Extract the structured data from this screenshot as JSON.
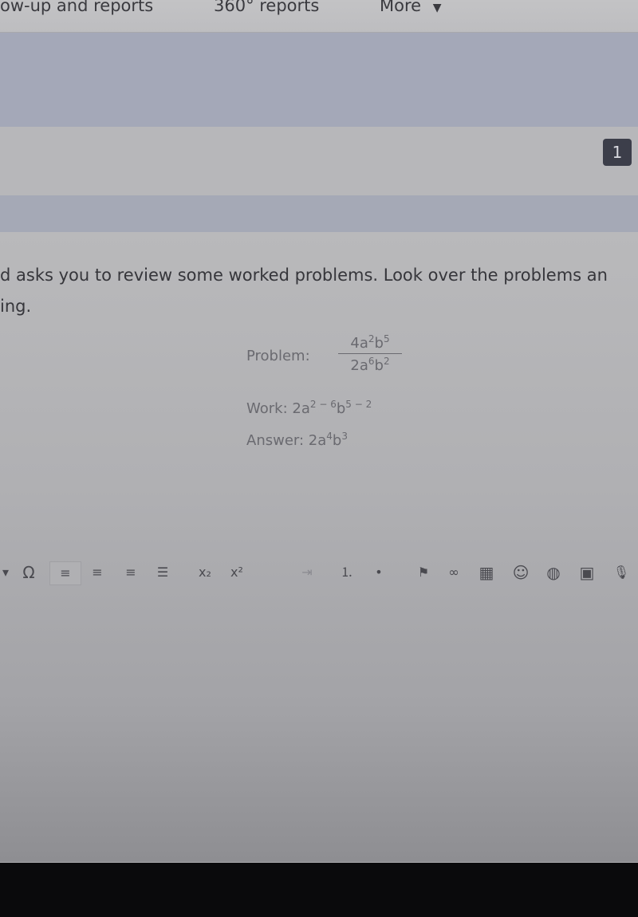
{
  "topnav": {
    "items": [
      "ow-up and reports",
      "360° reports",
      "More"
    ],
    "more_icon": "caret-down-icon"
  },
  "question": {
    "number": "1",
    "prompt_line1": "d asks you to review some worked problems. Look over the problems an",
    "prompt_line2": "ing.",
    "problem_label": "Problem:",
    "numerator": {
      "coef": "4a",
      "exp_a": "2",
      "b": "b",
      "exp_b": "5"
    },
    "denominator": {
      "coef": "2a",
      "exp_a": "6",
      "b": "b",
      "exp_b": "2"
    },
    "work_label": "Work:",
    "work": {
      "coef": "2a",
      "exp_a": "2 − 6",
      "b": "b",
      "exp_b": "5 − 2"
    },
    "answer_label": "Answer:",
    "answer": {
      "coef": "2a",
      "exp_a": "4",
      "b": "b",
      "exp_b": "3"
    }
  },
  "toolbar": {
    "buttons": [
      {
        "icon": "dropdown-caret-icon",
        "glyph": "▾"
      },
      {
        "icon": "special-character-icon",
        "glyph": "Ω"
      },
      {
        "icon": "align-left-icon",
        "glyph": "≡",
        "active": true
      },
      {
        "icon": "align-center-icon",
        "glyph": "≡"
      },
      {
        "icon": "align-right-icon",
        "glyph": "≡"
      },
      {
        "icon": "justify-icon",
        "glyph": "☰"
      },
      {
        "icon": "subscript-icon",
        "glyph": "x₂"
      },
      {
        "icon": "superscript-icon",
        "glyph": "x²"
      },
      {
        "icon": "indent-icon",
        "glyph": "⇥"
      },
      {
        "icon": "numbered-list-icon",
        "glyph": "⒈"
      },
      {
        "icon": "bulleted-list-icon",
        "glyph": "•"
      },
      {
        "icon": "flag-icon",
        "glyph": "⚑"
      },
      {
        "icon": "link-icon",
        "glyph": "∞"
      },
      {
        "icon": "table-icon",
        "glyph": "▦"
      },
      {
        "icon": "emoji-icon",
        "glyph": "☺"
      },
      {
        "icon": "globe-icon",
        "glyph": "◍"
      },
      {
        "icon": "image-icon",
        "glyph": "▣"
      },
      {
        "icon": "microphone-icon",
        "glyph": "🎙"
      }
    ]
  }
}
